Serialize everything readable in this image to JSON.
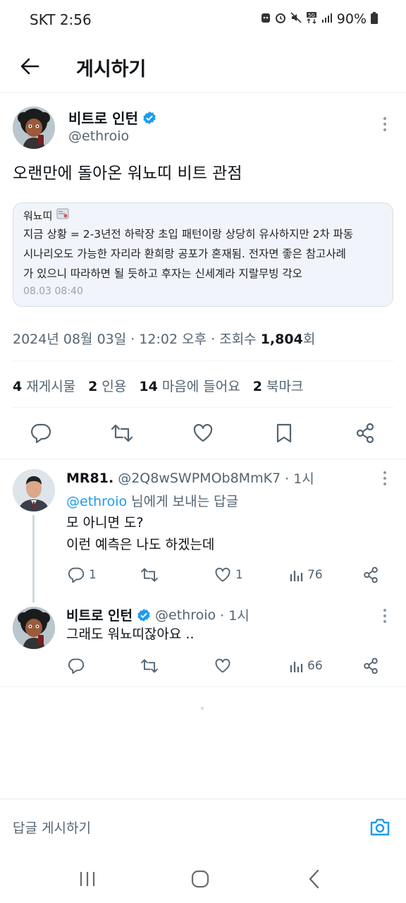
{
  "status_bar": {
    "carrier_time": "SKT 2:56",
    "battery": "90%"
  },
  "header": {
    "title": "게시하기"
  },
  "tweet": {
    "author_name": "비트로 인턴",
    "author_handle": "@ethroio",
    "text": "오랜만에 돌아온 워뇨띠 비트 관점",
    "quote": {
      "title": "워뇨띠",
      "lines": [
        "지금 상황 = 2-3년전 하락장 초입 패턴이랑 상당히 유사하지만 2차 파동",
        "시나리오도 가능한 자리라 환희랑 공포가 혼재됨. 전자면 좋은 참고사례",
        "가 있으니 따라하면 될 듯하고 후자는 신세계라 지랄무빙 각오"
      ],
      "time": "08.03 08:40"
    },
    "meta_prefix": "2024년 08월 03일 · 12:02 오후 · 조회수 ",
    "views": "1,804",
    "views_suffix": "회",
    "stats": {
      "retweets_count": "4",
      "retweets_label": "재게시물",
      "quotes_count": "2",
      "quotes_label": "인용",
      "likes_count": "14",
      "likes_label": "마음에 들어요",
      "bookmarks_count": "2",
      "bookmarks_label": "북마크"
    }
  },
  "replies": [
    {
      "name": "MR81.",
      "handle": "@2Q8wSWPMOb8MmK7",
      "time": "· 1시",
      "reply_to_mention": "@ethroio",
      "reply_to_suffix": " 님에게 보내는 답글",
      "lines": [
        "모 아니면 도?",
        "이런 예측은 나도 하겠는데"
      ],
      "replies": "1",
      "likes": "1",
      "views": "76"
    },
    {
      "name": "비트로 인턴",
      "handle": "@ethroio",
      "time": "· 1시",
      "lines": [
        "그래도 워뇨띠잖아요 .."
      ],
      "views": "66"
    }
  ],
  "compose": {
    "placeholder": "답글 게시하기"
  },
  "colors": {
    "accent": "#1d9bf0",
    "text": "#0f1419",
    "muted": "#536471"
  }
}
